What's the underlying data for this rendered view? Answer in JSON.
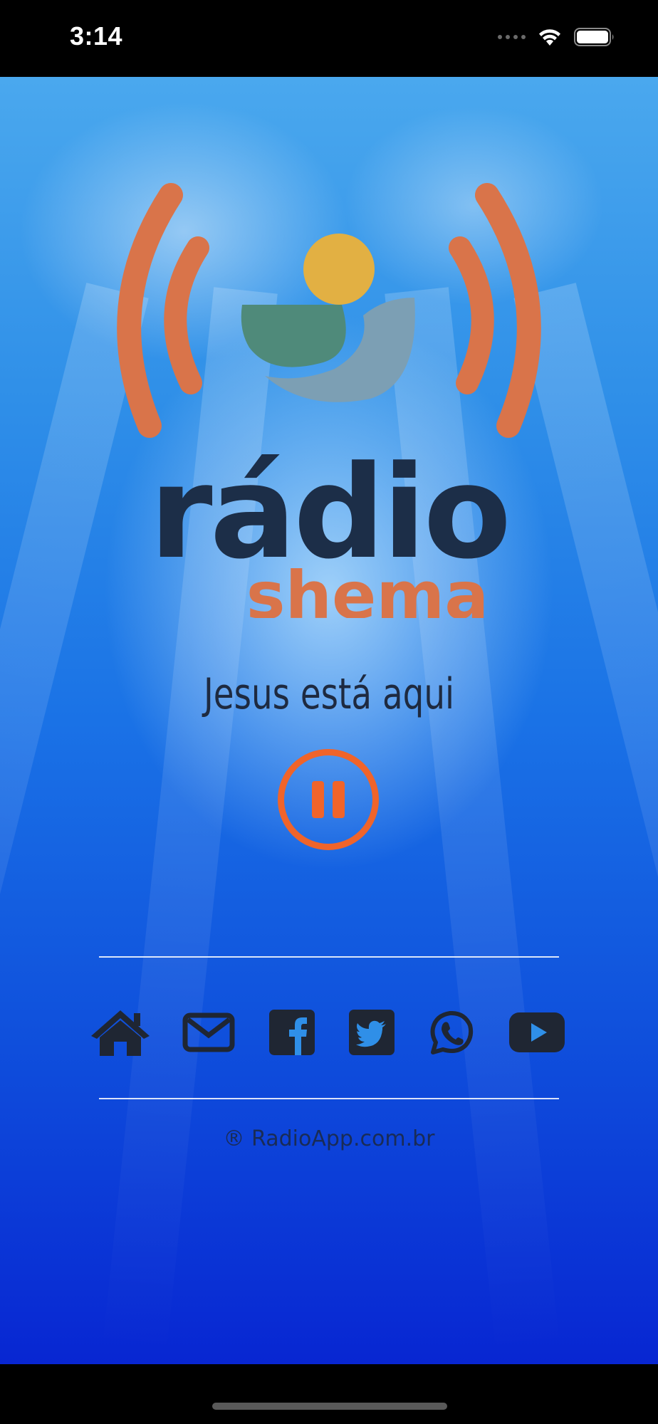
{
  "status_bar": {
    "time": "3:14"
  },
  "logo": {
    "word_1": "rádio",
    "word_2": "shema"
  },
  "player": {
    "now_playing": "Jesus está aqui",
    "state": "playing",
    "control_icon": "pause-icon"
  },
  "social_icons": [
    "home-icon",
    "mail-icon",
    "facebook-icon",
    "twitter-icon",
    "whatsapp-icon",
    "youtube-icon"
  ],
  "footer": {
    "copyright": "® RadioApp.com.br"
  },
  "colors": {
    "accent_orange": "#f0642a",
    "logo_orange": "#d9744a",
    "logo_navy": "#1c2e48",
    "icon_dark": "#1f2633",
    "sky_blue": "#2f8fe8",
    "deep_blue": "#0826d2"
  }
}
